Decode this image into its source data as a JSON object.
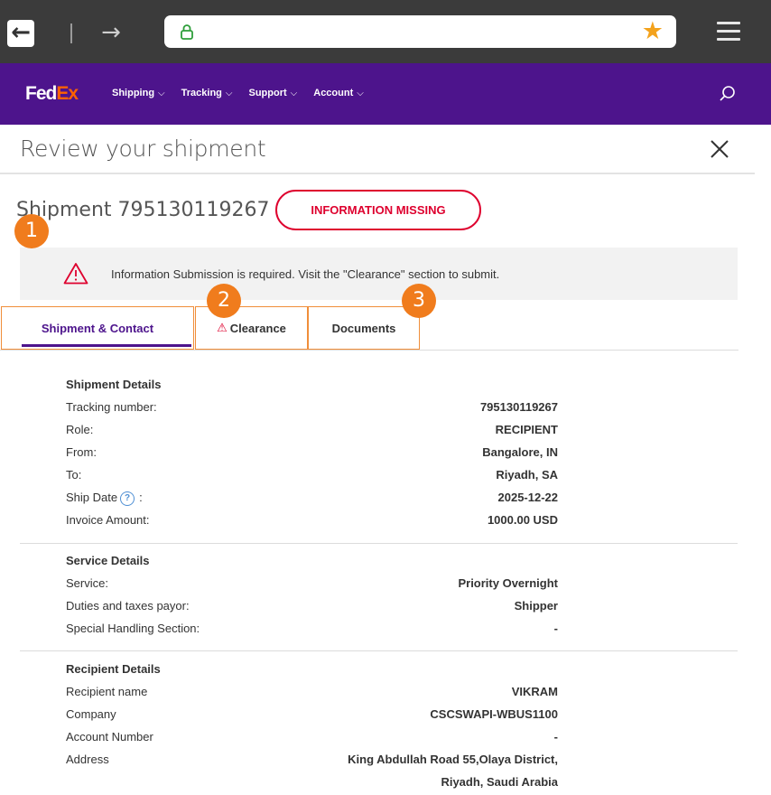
{
  "browser": {
    "back_label": "←",
    "forward_label": "→",
    "url": "",
    "star": "★"
  },
  "header": {
    "logo_fed": "Fed",
    "logo_ex": "Ex",
    "nav": [
      {
        "label": "Shipping"
      },
      {
        "label": "Tracking"
      },
      {
        "label": "Support"
      },
      {
        "label": "Account"
      }
    ],
    "chevron": "⌵"
  },
  "page": {
    "title": "Review your shipment",
    "shipment_label": "Shipment 795130119267",
    "status_badge": "INFORMATION MISSING",
    "alert_text": "Information Submission is required. Visit the \"Clearance\" section to submit.",
    "markers": [
      "1",
      "2",
      "3"
    ]
  },
  "tabs": [
    {
      "label": "Shipment & Contact"
    },
    {
      "label": "Clearance"
    },
    {
      "label": "Documents"
    }
  ],
  "shipment_details": {
    "title": "Shipment Details",
    "rows": [
      {
        "label": "Tracking number:",
        "value": "795130119267"
      },
      {
        "label": "Role:",
        "value": "RECIPIENT"
      },
      {
        "label": "From:",
        "value": "Bangalore, IN"
      },
      {
        "label": "To:",
        "value": "Riyadh, SA"
      },
      {
        "label": "Ship Date",
        "suffix": ":",
        "value": "2025-12-22"
      },
      {
        "label": "Invoice Amount:",
        "value": "1000.00 USD"
      }
    ]
  },
  "service_details": {
    "title": "Service Details",
    "rows": [
      {
        "label": "Service:",
        "value": "Priority Overnight"
      },
      {
        "label": "Duties and taxes payor:",
        "value": "Shipper"
      },
      {
        "label": "Special Handling Section:",
        "value": "-"
      }
    ]
  },
  "recipient_details": {
    "title": "Recipient Details",
    "rows": [
      {
        "label": "Recipient name",
        "value": "VIKRAM"
      },
      {
        "label": "Company",
        "value": "CSCSWAPI-WBUS1100"
      },
      {
        "label": "Account Number",
        "value": "-"
      },
      {
        "label": "Address",
        "value": "King Abdullah Road 55,Olaya District,"
      }
    ],
    "address_line2": "Riyadh, Saudi Arabia"
  },
  "help_glyph": "?",
  "warn_glyph": "⚠"
}
